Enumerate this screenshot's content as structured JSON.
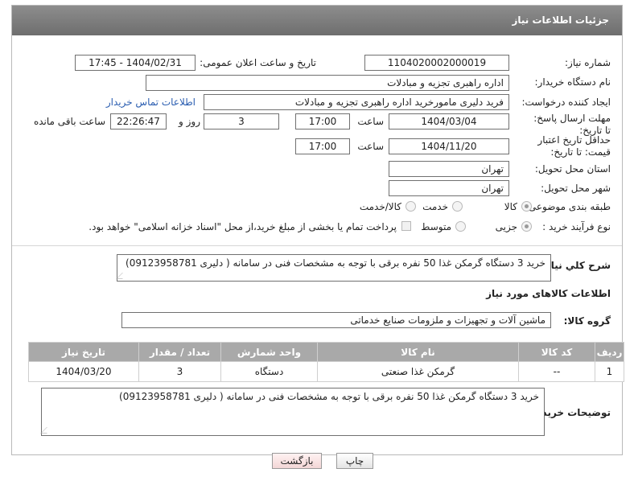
{
  "header": {
    "title": "جزئیات اطلاعات نیاز"
  },
  "fields": {
    "need_number": {
      "label": "شماره نیاز:",
      "value": "1104020002000019"
    },
    "announce_date": {
      "label": "تاریخ و ساعت اعلان عمومی:",
      "value": "1404/02/31 - 17:45"
    },
    "buyer_org": {
      "label": "نام دستگاه خریدار:",
      "value": "اداره راهبری تجزیه و مبادلات"
    },
    "requester": {
      "label": "ایجاد کننده درخواست:",
      "value": "فرید دلیری مامورخرید اداره راهبری تجزیه و مبادلات",
      "contact_link": "اطلاعات تماس خریدار"
    },
    "reply_deadline": {
      "label": "مهلت ارسال پاسخ: تا تاریخ:",
      "date": "1404/03/04",
      "time_label": "ساعت",
      "time": "17:00",
      "days": "3",
      "days_label": "روز و",
      "remaining": "22:26:47",
      "remaining_label": "ساعت باقی مانده"
    },
    "price_validity": {
      "label": "حداقل تاریخ اعتبار قیمت: تا تاریخ:",
      "date": "1404/11/20",
      "time_label": "ساعت",
      "time": "17:00"
    },
    "delivery_province": {
      "label": "استان محل تحویل:",
      "value": "تهران"
    },
    "delivery_city": {
      "label": "شهر محل تحویل:",
      "value": "تهران"
    },
    "category": {
      "label": "طبقه بندی موضوعی:",
      "options": [
        "کالا",
        "خدمت",
        "کالا/خدمت"
      ],
      "selected": "کالا"
    },
    "process": {
      "label": "نوع فرآیند خرید :",
      "options": [
        "جزیی",
        "متوسط"
      ],
      "selected": "جزیی",
      "payment_note": "پرداخت تمام یا بخشی از مبلغ خرید،از محل \"اسناد خزانه اسلامی\" خواهد بود."
    }
  },
  "description": {
    "label": "شرح کلي نياز:",
    "value": "خرید 3 دستگاه گرمکن غذا 50 نفره برقی با توجه به مشخصات فنی در سامانه ( دلیری 09123958781)"
  },
  "goods_section": {
    "title": "اطلاعات کالاهای مورد نیاز",
    "group_label": "گروه کالا:",
    "group_value": "ماشین آلات و تجهیزات و ملزومات صنایع خدماتی"
  },
  "table": {
    "headers": [
      "ردیف",
      "کد کالا",
      "نام کالا",
      "واحد شمارش",
      "تعداد / مقدار",
      "تاریخ نیاز"
    ],
    "rows": [
      [
        "1",
        "--",
        "گرمکن غذا صنعتی",
        "دستگاه",
        "3",
        "1404/03/20"
      ]
    ]
  },
  "buyer_notes": {
    "label": "توضیحات خریدار:",
    "value": "خرید 3 دستگاه گرمکن غذا 50 نفره برقی با توجه به مشخصات فنی در سامانه ( دلیری 09123958781)"
  },
  "buttons": {
    "print": "چاپ",
    "back": "بازگشت"
  },
  "colors": {
    "header_bg": "#7d7d7d",
    "table_header_bg": "#a9a9a9",
    "link": "#2a5db0"
  }
}
